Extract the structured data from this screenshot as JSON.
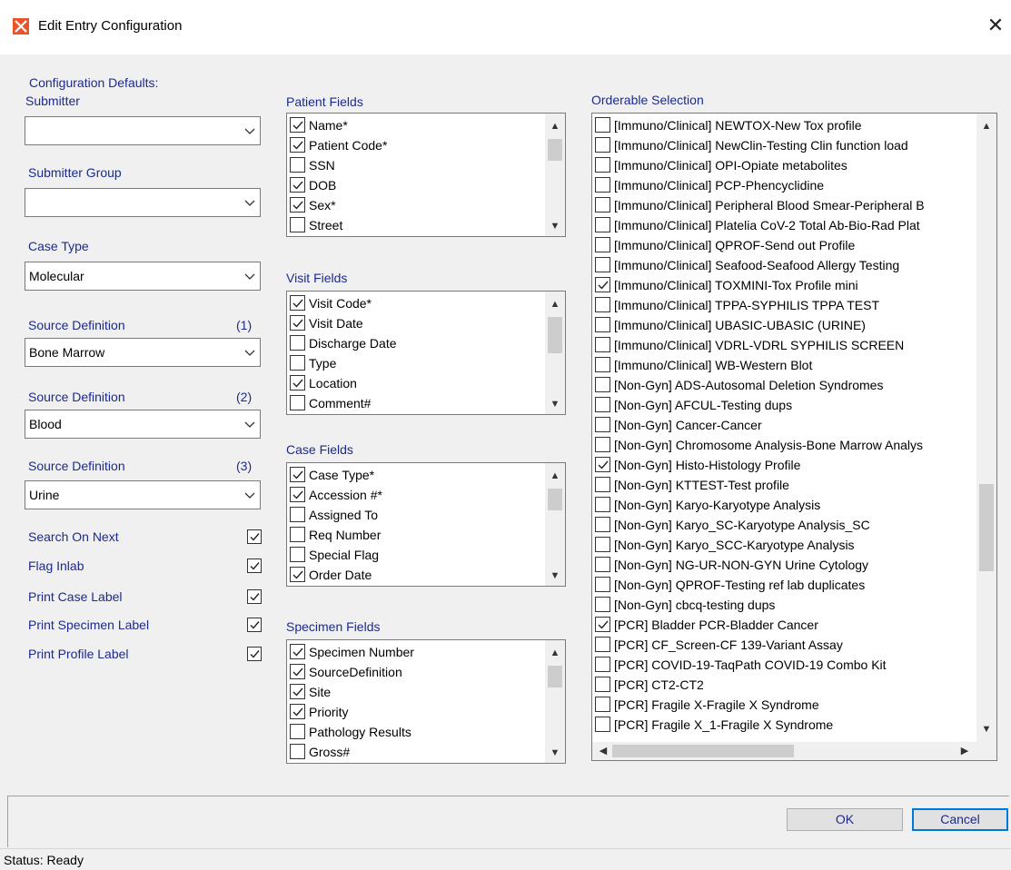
{
  "window": {
    "title": "Edit Entry Configuration",
    "close_glyph": "✕",
    "app_icon": "app-logo-icon",
    "accent": "#e8552d"
  },
  "left": {
    "config_defaults_label": "Configuration Defaults:",
    "submitter_label": "Submitter",
    "submitter_value": "",
    "submitter_group_label": "Submitter Group",
    "submitter_group_value": "",
    "case_type_label": "Case Type",
    "case_type_value": "Molecular",
    "source_defs": [
      {
        "label": "Source Definition",
        "index": "(1)",
        "value": "Bone Marrow"
      },
      {
        "label": "Source Definition",
        "index": "(2)",
        "value": "Blood"
      },
      {
        "label": "Source Definition",
        "index": "(3)",
        "value": "Urine"
      }
    ],
    "options": [
      {
        "label": "Search On Next",
        "checked": true
      },
      {
        "label": "Flag Inlab",
        "checked": true
      },
      {
        "label": "Print Case Label",
        "checked": true
      },
      {
        "label": "Print Specimen Label",
        "checked": true
      },
      {
        "label": "Print Profile Label",
        "checked": true
      }
    ]
  },
  "patient_fields": {
    "label": "Patient Fields",
    "items": [
      {
        "text": "Name*",
        "checked": true
      },
      {
        "text": "Patient Code*",
        "checked": true
      },
      {
        "text": "SSN",
        "checked": false
      },
      {
        "text": "DOB",
        "checked": true
      },
      {
        "text": "Sex*",
        "checked": true
      },
      {
        "text": "Street",
        "checked": false
      }
    ]
  },
  "visit_fields": {
    "label": "Visit Fields",
    "items": [
      {
        "text": "Visit Code*",
        "checked": true
      },
      {
        "text": "Visit Date",
        "checked": true
      },
      {
        "text": "Discharge Date",
        "checked": false
      },
      {
        "text": "Type",
        "checked": false
      },
      {
        "text": "Location",
        "checked": true
      },
      {
        "text": "Comment#",
        "checked": false
      }
    ]
  },
  "case_fields": {
    "label": "Case Fields",
    "items": [
      {
        "text": "Case Type*",
        "checked": true
      },
      {
        "text": "Accession #*",
        "checked": true
      },
      {
        "text": "Assigned To",
        "checked": false
      },
      {
        "text": "Req Number",
        "checked": false
      },
      {
        "text": "Special Flag",
        "checked": false
      },
      {
        "text": "Order Date",
        "checked": true
      }
    ]
  },
  "specimen_fields": {
    "label": "Specimen Fields",
    "items": [
      {
        "text": "Specimen Number",
        "checked": true
      },
      {
        "text": "SourceDefinition",
        "checked": true
      },
      {
        "text": "Site",
        "checked": true
      },
      {
        "text": "Priority",
        "checked": true
      },
      {
        "text": "Pathology Results",
        "checked": false
      },
      {
        "text": "Gross#",
        "checked": false
      }
    ]
  },
  "orderable": {
    "label": "Orderable Selection",
    "items": [
      {
        "text": "[Immuno/Clinical] NEWTOX-New Tox profile",
        "checked": false
      },
      {
        "text": "[Immuno/Clinical] NewClin-Testing Clin function load",
        "checked": false
      },
      {
        "text": "[Immuno/Clinical] OPI-Opiate metabolites",
        "checked": false
      },
      {
        "text": "[Immuno/Clinical] PCP-Phencyclidine",
        "checked": false
      },
      {
        "text": "[Immuno/Clinical] Peripheral Blood Smear-Peripheral B",
        "checked": false
      },
      {
        "text": "[Immuno/Clinical] Platelia CoV-2 Total Ab-Bio-Rad Plat",
        "checked": false
      },
      {
        "text": "[Immuno/Clinical] QPROF-Send out Profile",
        "checked": false
      },
      {
        "text": "[Immuno/Clinical] Seafood-Seafood Allergy Testing",
        "checked": false
      },
      {
        "text": "[Immuno/Clinical] TOXMINI-Tox Profile mini",
        "checked": true
      },
      {
        "text": "[Immuno/Clinical] TPPA-SYPHILIS TPPA TEST",
        "checked": false
      },
      {
        "text": "[Immuno/Clinical] UBASIC-UBASIC (URINE)",
        "checked": false
      },
      {
        "text": "[Immuno/Clinical] VDRL-VDRL SYPHILIS SCREEN",
        "checked": false
      },
      {
        "text": "[Immuno/Clinical] WB-Western Blot",
        "checked": false
      },
      {
        "text": "[Non-Gyn] ADS-Autosomal Deletion Syndromes",
        "checked": false
      },
      {
        "text": "[Non-Gyn] AFCUL-Testing dups",
        "checked": false
      },
      {
        "text": "[Non-Gyn] Cancer-Cancer",
        "checked": false
      },
      {
        "text": "[Non-Gyn] Chromosome Analysis-Bone Marrow Analys",
        "checked": false
      },
      {
        "text": "[Non-Gyn] Histo-Histology Profile",
        "checked": true
      },
      {
        "text": "[Non-Gyn] KTTEST-Test profile",
        "checked": false
      },
      {
        "text": "[Non-Gyn] Karyo-Karyotype Analysis",
        "checked": false
      },
      {
        "text": "[Non-Gyn] Karyo_SC-Karyotype Analysis_SC",
        "checked": false
      },
      {
        "text": "[Non-Gyn] Karyo_SCC-Karyotype Analysis",
        "checked": false
      },
      {
        "text": "[Non-Gyn] NG-UR-NON-GYN Urine Cytology",
        "checked": false
      },
      {
        "text": "[Non-Gyn] QPROF-Testing ref lab duplicates",
        "checked": false
      },
      {
        "text": "[Non-Gyn] cbcq-testing dups",
        "checked": false
      },
      {
        "text": "[PCR] Bladder PCR-Bladder Cancer",
        "checked": true
      },
      {
        "text": "[PCR] CF_Screen-CF 139-Variant Assay",
        "checked": false
      },
      {
        "text": "[PCR] COVID-19-TaqPath COVID-19 Combo Kit",
        "checked": false
      },
      {
        "text": "[PCR] CT2-CT2",
        "checked": false
      },
      {
        "text": "[PCR] Fragile X-Fragile X Syndrome",
        "checked": false
      },
      {
        "text": "[PCR] Fragile X_1-Fragile X Syndrome",
        "checked": false
      }
    ]
  },
  "buttons": {
    "ok": "OK",
    "cancel": "Cancel"
  },
  "status": {
    "text": "Status: Ready"
  }
}
